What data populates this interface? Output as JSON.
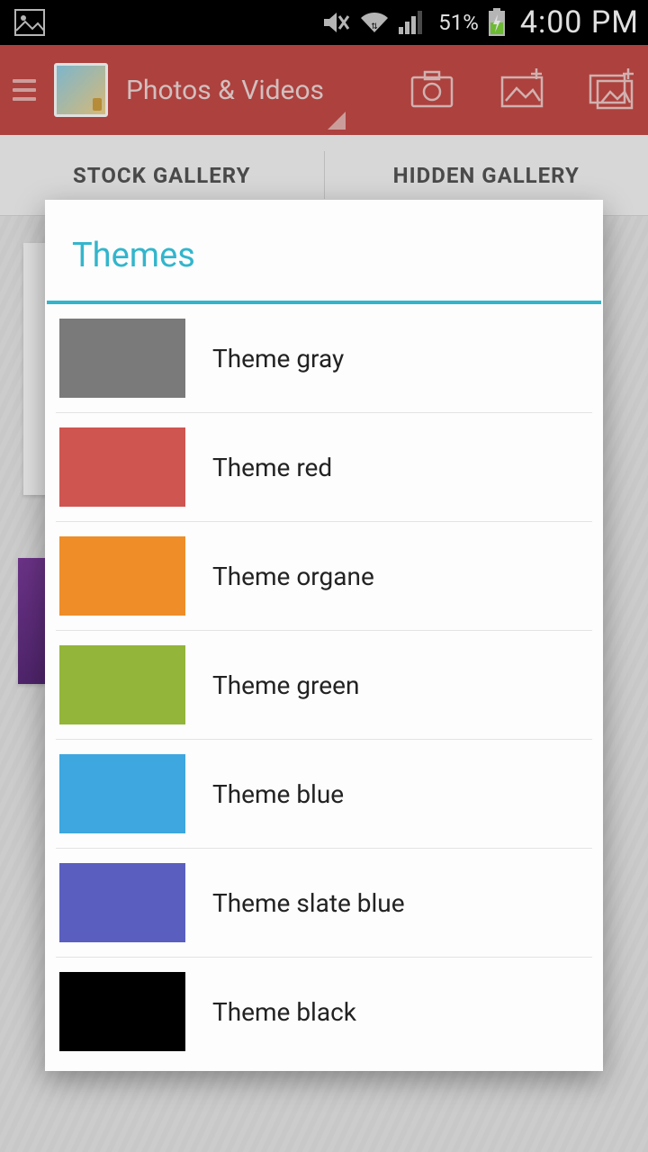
{
  "status": {
    "battery_pct": "51%",
    "time": "4:00 PM"
  },
  "appbar": {
    "title": "Photos & Videos"
  },
  "tabs": {
    "stock": "STOCK GALLERY",
    "hidden": "HIDDEN GALLERY"
  },
  "dialog": {
    "title": "Themes",
    "themes": [
      {
        "label": "Theme gray",
        "color": "#7a7a7a"
      },
      {
        "label": "Theme red",
        "color": "#cf5551"
      },
      {
        "label": "Theme organe",
        "color": "#ef8d28"
      },
      {
        "label": "Theme green",
        "color": "#93b53a"
      },
      {
        "label": "Theme blue",
        "color": "#3ea7df"
      },
      {
        "label": "Theme slate blue",
        "color": "#5a5fbf"
      },
      {
        "label": "Theme black",
        "color": "#000000"
      }
    ]
  }
}
